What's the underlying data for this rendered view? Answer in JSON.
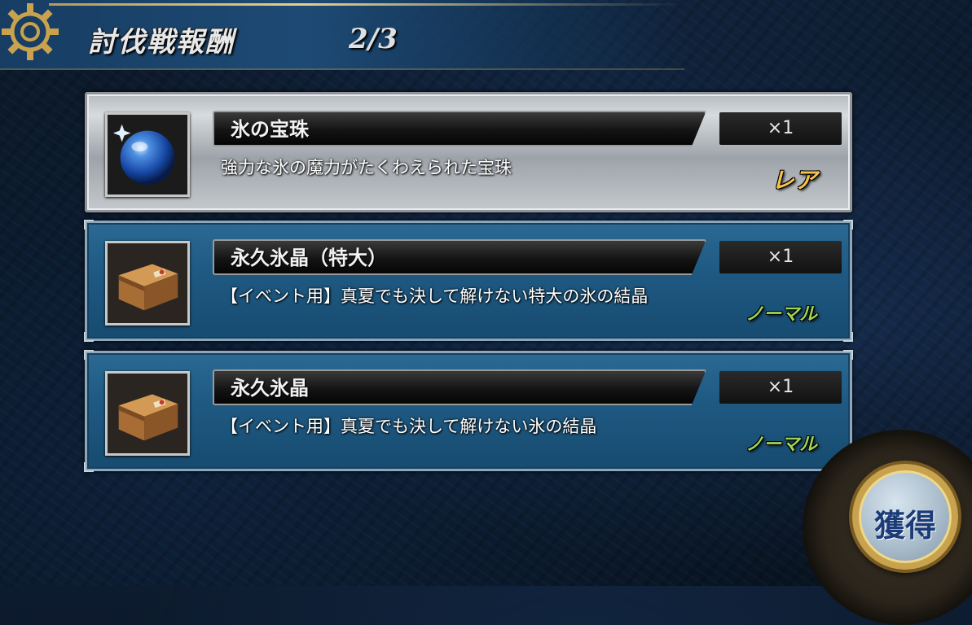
{
  "header": {
    "title": "討伐戦報酬",
    "page_indicator": "2/3"
  },
  "rewards": [
    {
      "name": "氷の宝珠",
      "quantity": "×1",
      "description": "強力な氷の魔力がたくわえられた宝珠",
      "rarity": "レア",
      "icon": "blue-orb-icon"
    },
    {
      "name": "永久氷晶（特大）",
      "quantity": "×1",
      "description": "【イベント用】真夏でも決して解けない特大の氷の結晶",
      "rarity": "ノーマル",
      "icon": "wooden-box-icon"
    },
    {
      "name": "永久氷晶",
      "quantity": "×1",
      "description": "【イベント用】真夏でも決して解けない氷の結晶",
      "rarity": "ノーマル",
      "icon": "wooden-box-icon"
    }
  ],
  "acquire_button": {
    "label": "獲得"
  },
  "colors": {
    "rare": "#f6c24a",
    "normal": "#9ed454",
    "row_blue": "#1f5a83"
  }
}
